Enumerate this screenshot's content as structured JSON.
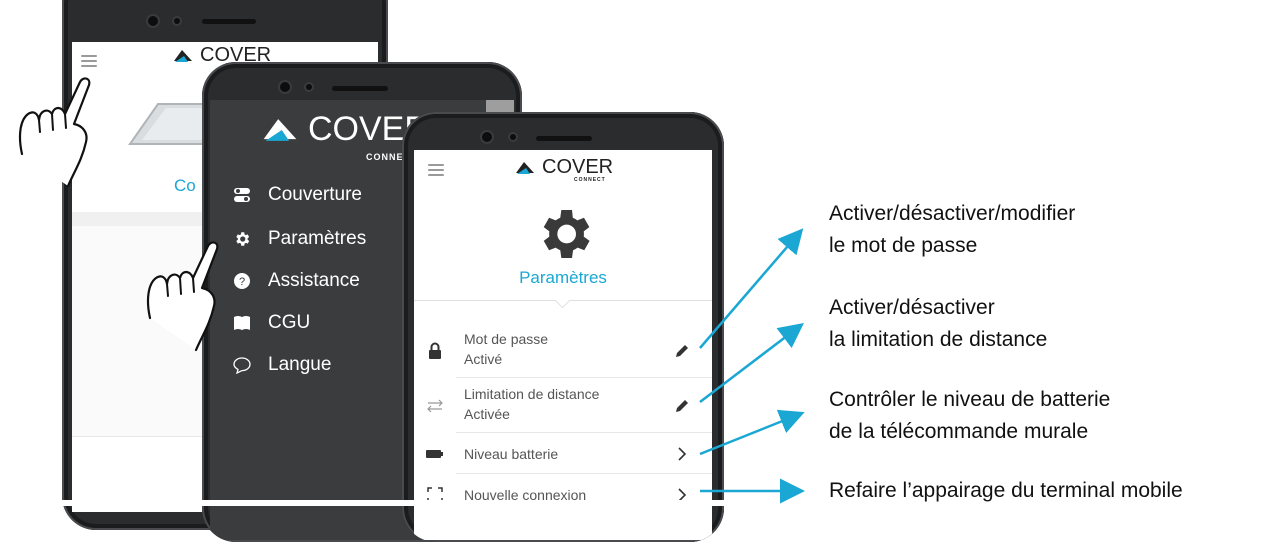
{
  "phone_left": {
    "logo_text": "COVER",
    "caption_partial": "Co"
  },
  "phone_middle": {
    "logo_text": "COVER",
    "logo_sub": "CONNECT",
    "drawer": [
      {
        "label": "Couverture",
        "icon": "toggle-icon"
      },
      {
        "label": "Paramètres",
        "icon": "gear-icon"
      },
      {
        "label": "Assistance",
        "icon": "help-icon"
      },
      {
        "label": "CGU",
        "icon": "book-icon"
      },
      {
        "label": "Langue",
        "icon": "chat-bubble-icon"
      }
    ]
  },
  "phone_front": {
    "logo_text": "COVER",
    "logo_sub": "CONNECT",
    "page_title": "Paramètres",
    "settings": [
      {
        "title": "Mot de passe",
        "status": "Activé",
        "icon": "lock-icon",
        "action": "edit-icon"
      },
      {
        "title": "Limitation de distance",
        "status": "Activée",
        "icon": "arrows-icon",
        "action": "edit-icon"
      },
      {
        "title": "Niveau batterie",
        "status": "",
        "icon": "battery-icon",
        "action": "chevron-right-icon"
      },
      {
        "title": "Nouvelle connexion",
        "status": "",
        "icon": "scan-frame-icon",
        "action": "chevron-right-icon"
      }
    ]
  },
  "annotations": [
    {
      "line1": "Activer/désactiver/modifier",
      "line2": "le mot de passe"
    },
    {
      "line1": "Activer/désactiver",
      "line2": "la limitation de distance"
    },
    {
      "line1": "Contrôler le niveau de batterie",
      "line2": "de la télécommande murale"
    },
    {
      "line1": "Refaire l’appairage du terminal mobile",
      "line2": ""
    }
  ],
  "colors": {
    "accent": "#1aa7d4",
    "phone_body": "#2b2c2e",
    "drawer_bg": "#3b3c3d",
    "arrow": "#1aa7d4"
  }
}
